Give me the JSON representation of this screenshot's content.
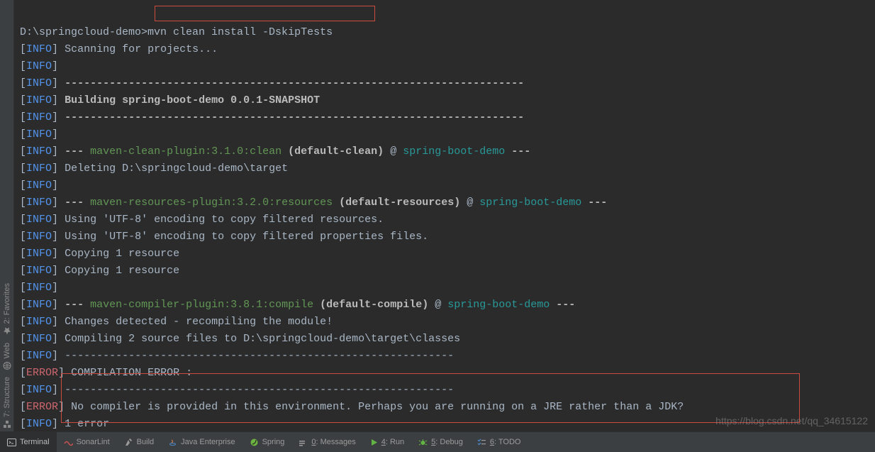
{
  "prompt": {
    "path": "D:\\springcloud-demo>",
    "command": "mvn clean install -DskipTests"
  },
  "log": {
    "scanning": "Scanning for projects...",
    "dash72": "------------------------------------------------------------------------",
    "dash71": "-------------------------------------------------------------",
    "building": "Building spring-boot-demo 0.0.1-SNAPSHOT",
    "cleanPlugin": "maven-clean-plugin:3.1.0:clean",
    "cleanGoal": "(default-clean)",
    "at": "@",
    "project": "spring-boot-demo",
    "tripleDash": "---",
    "deleting": "Deleting D:\\springcloud-demo\\target",
    "resourcesPlugin": "maven-resources-plugin:3.2.0:resources",
    "resourcesGoal": "(default-resources)",
    "utf1": "Using 'UTF-8' encoding to copy filtered resources.",
    "utf2": "Using 'UTF-8' encoding to copy filtered properties files.",
    "copy1": "Copying 1 resource",
    "compilerPlugin": "maven-compiler-plugin:3.8.1:compile",
    "compilerGoal": "(default-compile)",
    "changes": "Changes detected - recompiling the module!",
    "compiling": "Compiling 2 source files to D:\\springcloud-demo\\target\\classes",
    "compErr": "COMPILATION ERROR :",
    "noCompiler": "No compiler is provided in this environment. Perhaps you are running on a JRE rather than a JDK?",
    "oneError": "1 error"
  },
  "labels": {
    "INFO": "INFO",
    "ERROR": "ERROR"
  },
  "gutter": {
    "favorites": "2: Favorites",
    "web": "Web",
    "structure": "7: Structure"
  },
  "toolbar": {
    "terminal": "Terminal",
    "sonarlint": "SonarLint",
    "build": "Build",
    "javaEnterprise": "Java Enterprise",
    "spring": "Spring",
    "messages": "0: Messages",
    "run": "4: Run",
    "debug": "5: Debug",
    "todo": "6: TODO"
  },
  "watermark": "https://blog.csdn.net/qq_34615122"
}
